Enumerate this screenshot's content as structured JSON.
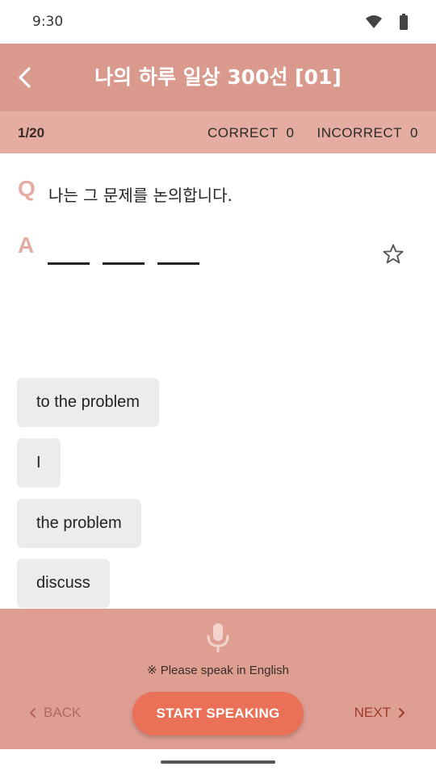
{
  "status_bar": {
    "time": "9:30",
    "icons": [
      "wifi-icon",
      "battery-icon"
    ]
  },
  "header": {
    "title": "나의 하루 일상 300선 [01]",
    "back_icon": "chevron-left-icon",
    "background_color": "#d99a8d"
  },
  "score": {
    "progress": "1/20",
    "correct_label": "CORRECT",
    "correct_value": "0",
    "incorrect_label": "INCORRECT",
    "incorrect_value": "0",
    "background_color": "#e5ada2"
  },
  "question": {
    "q_label": "Q",
    "text": "나는 그 문제를 논의합니다.",
    "a_label": "A",
    "blank_count": 3,
    "favorite_icon": "star-outline-icon"
  },
  "options": [
    {
      "label": "to the problem"
    },
    {
      "label": "I"
    },
    {
      "label": "the problem"
    },
    {
      "label": "discuss"
    }
  ],
  "bottom": {
    "mic_icon": "microphone-icon",
    "hint": "※ Please speak in English",
    "back_label": "BACK",
    "start_label": "START SPEAKING",
    "next_label": "NEXT",
    "accent_color": "#ea7057",
    "panel_color": "#de9e92"
  }
}
